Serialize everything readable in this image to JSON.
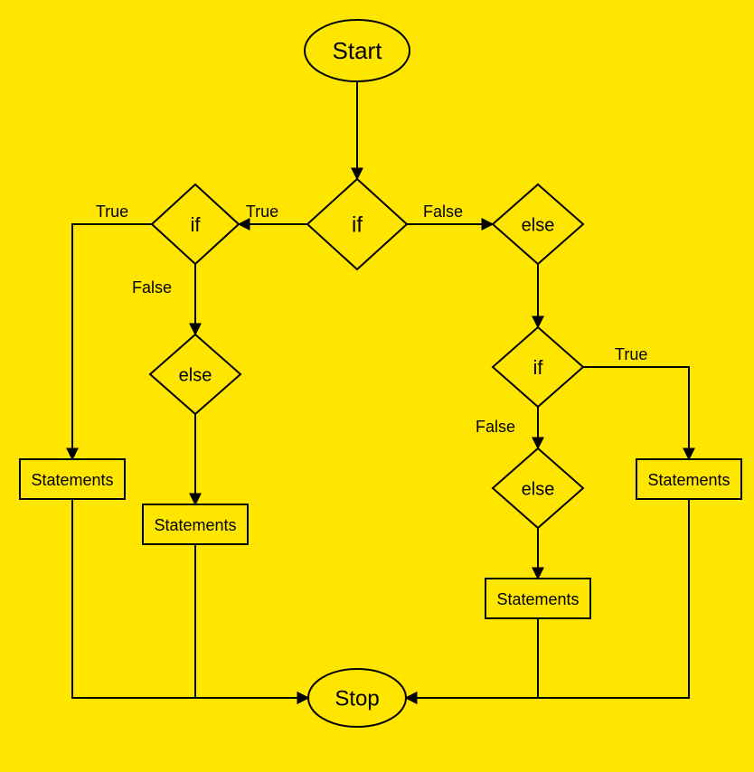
{
  "nodes": {
    "start": "Start",
    "stop": "Stop",
    "if_top": "if",
    "if_left": "if",
    "else_left": "else",
    "else_right": "else",
    "if_right2": "if",
    "else_right2": "else",
    "stmt_far_left": "Statements",
    "stmt_left": "Statements",
    "stmt_right": "Statements",
    "stmt_far_right": "Statements"
  },
  "labels": {
    "true": "True",
    "false": "False"
  }
}
